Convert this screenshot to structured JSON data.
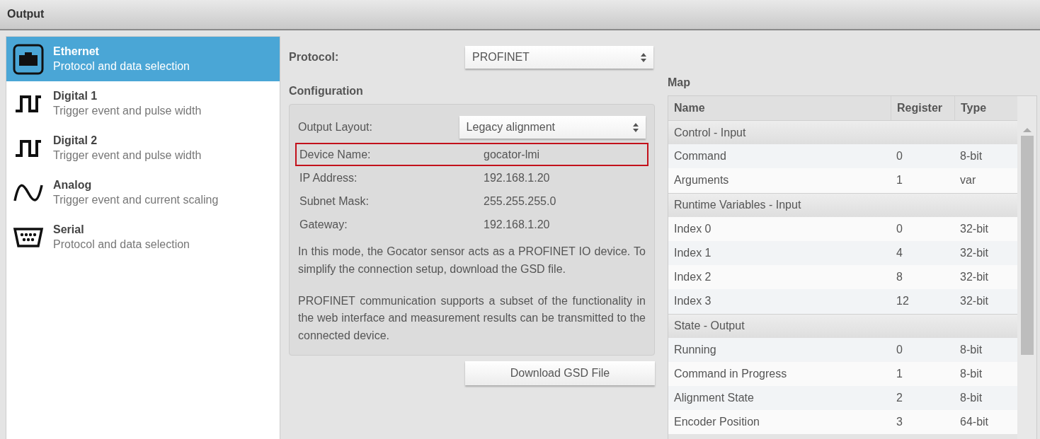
{
  "header": {
    "title": "Output"
  },
  "sidebar": {
    "items": [
      {
        "kind": "ethernet",
        "title": "Ethernet",
        "subtitle": "Protocol and data selection",
        "selected": true
      },
      {
        "kind": "digital",
        "title": "Digital 1",
        "subtitle": "Trigger event and pulse width",
        "selected": false
      },
      {
        "kind": "digital",
        "title": "Digital 2",
        "subtitle": "Trigger event and pulse width",
        "selected": false
      },
      {
        "kind": "analog",
        "title": "Analog",
        "subtitle": "Trigger event and current scaling",
        "selected": false
      },
      {
        "kind": "serial",
        "title": "Serial",
        "subtitle": "Protocol and data selection",
        "selected": false
      }
    ]
  },
  "protocol": {
    "label": "Protocol:",
    "value": "PROFINET"
  },
  "configuration": {
    "title": "Configuration",
    "layout": {
      "label": "Output Layout:",
      "value": "Legacy alignment"
    },
    "fields": [
      {
        "label": "Device Name:",
        "value": "gocator-lmi",
        "highlighted": true
      },
      {
        "label": "IP Address:",
        "value": "192.168.1.20",
        "highlighted": false
      },
      {
        "label": "Subnet Mask:",
        "value": "255.255.255.0",
        "highlighted": false
      },
      {
        "label": "Gateway:",
        "value": "192.168.1.20",
        "highlighted": false
      }
    ],
    "paragraphs": [
      "In this mode, the Gocator sensor acts as a PROFINET IO device. To simplify the connection setup, download the GSD file.",
      "PROFINET communication supports a subset of the functionality in the web interface and measurement results can be transmitted to the connected device."
    ],
    "button": "Download GSD File"
  },
  "map": {
    "title": "Map",
    "columns": [
      "Name",
      "Register",
      "Type"
    ],
    "rows": [
      {
        "kind": "group",
        "name": "Control - Input"
      },
      {
        "kind": "item",
        "name": "Command",
        "register": "0",
        "type": "8-bit"
      },
      {
        "kind": "item",
        "name": "Arguments",
        "register": "1",
        "type": "var"
      },
      {
        "kind": "group",
        "name": "Runtime Variables - Input"
      },
      {
        "kind": "item",
        "name": "Index 0",
        "register": "0",
        "type": "32-bit"
      },
      {
        "kind": "item",
        "name": "Index 1",
        "register": "4",
        "type": "32-bit"
      },
      {
        "kind": "item",
        "name": "Index 2",
        "register": "8",
        "type": "32-bit"
      },
      {
        "kind": "item",
        "name": "Index 3",
        "register": "12",
        "type": "32-bit"
      },
      {
        "kind": "group",
        "name": "State - Output"
      },
      {
        "kind": "item",
        "name": "Running",
        "register": "0",
        "type": "8-bit"
      },
      {
        "kind": "item",
        "name": "Command in Progress",
        "register": "1",
        "type": "8-bit"
      },
      {
        "kind": "item",
        "name": "Alignment State",
        "register": "2",
        "type": "8-bit"
      },
      {
        "kind": "item",
        "name": "Encoder Position",
        "register": "3",
        "type": "64-bit"
      }
    ]
  }
}
